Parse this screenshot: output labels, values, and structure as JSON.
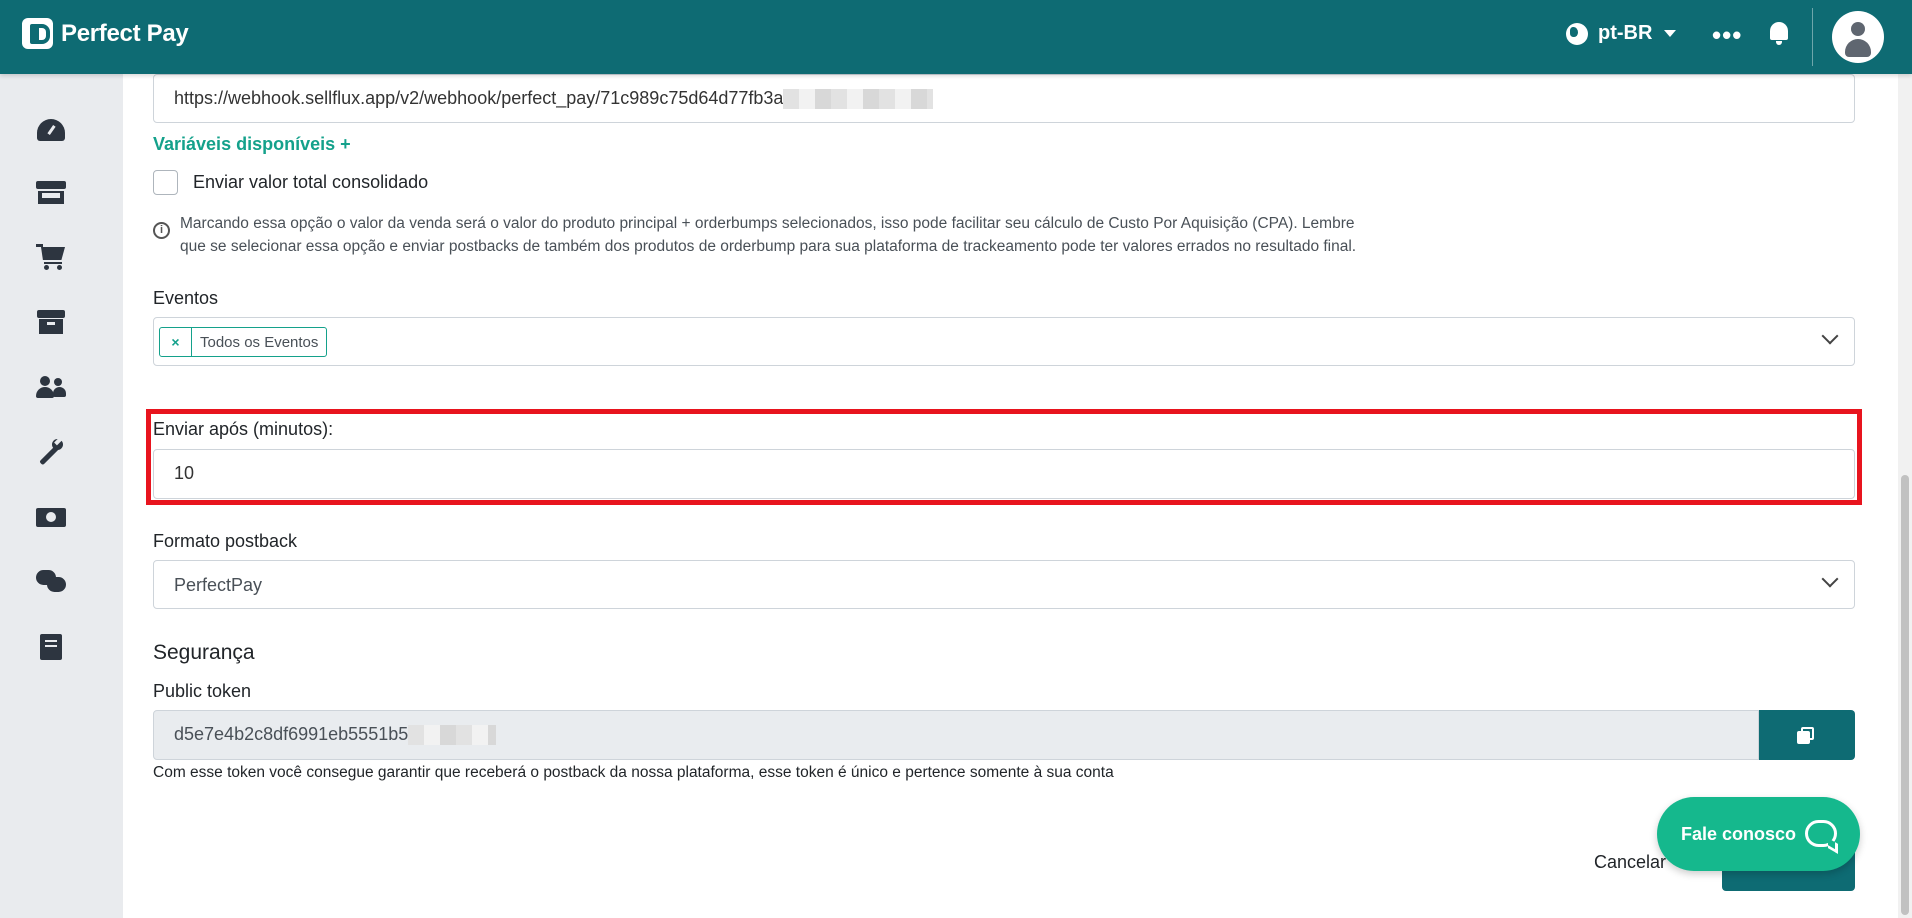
{
  "app": {
    "brand": "Perfect Pay"
  },
  "topbar": {
    "language": "pt-BR",
    "icons": [
      "globe-icon",
      "chevron-down-icon",
      "more-icon",
      "bell-icon",
      "user-avatar-icon"
    ]
  },
  "sidebar": {
    "items": [
      {
        "icon": "dashboard-icon"
      },
      {
        "icon": "store-icon"
      },
      {
        "icon": "cart-icon"
      },
      {
        "icon": "box-icon"
      },
      {
        "icon": "users-icon"
      },
      {
        "icon": "wrench-icon"
      },
      {
        "icon": "money-icon"
      },
      {
        "icon": "chat-icon"
      },
      {
        "icon": "book-icon"
      }
    ]
  },
  "form": {
    "webhook_url": "https://webhook.sellflux.app/v2/webhook/perfect_pay/71c989c75d64d77fb3a",
    "variables_link": "Variáveis disponíveis +",
    "consolidated_checkbox": {
      "label": "Enviar valor total consolidado",
      "checked": false
    },
    "info_text_line1": "Marcando essa opção o valor da venda será o valor do produto principal + orderbumps selecionados, isso pode facilitar seu cálculo de Custo Por Aquisição (CPA). Lembre",
    "info_text_line2": "que se selecionar essa opção e enviar postbacks de também dos produtos de orderbump para sua plataforma de trackeamento pode ter valores errados no resultado final.",
    "events_label": "Eventos",
    "events_tag": "Todos os Eventos",
    "events_tag_remove": "×",
    "send_after_label": "Enviar após (minutos):",
    "send_after_value": "10",
    "postback_format_label": "Formato postback",
    "postback_format_value": "PerfectPay",
    "security_title": "Segurança",
    "public_token_label": "Public token",
    "public_token_value": "d5e7e4b2c8df6991eb5551b5",
    "public_token_help": "Com esse token você consegue garantir que receberá o postback da nossa plataforma, esse token é único e pertence somente à sua conta",
    "cancel_label": "Cancelar"
  },
  "chat_widget": {
    "label": "Fale conosco"
  },
  "colors": {
    "primary": "#0e6b73",
    "accent": "#14a18b",
    "highlight": "#e8141e",
    "chat": "#15b88d"
  }
}
